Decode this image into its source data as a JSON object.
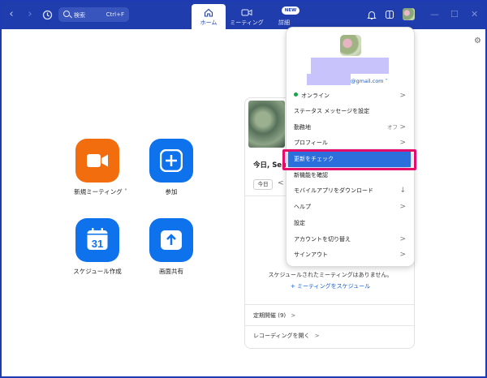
{
  "titlebar": {
    "search_label": "検索",
    "search_shortcut": "Ctrl+F",
    "tabs": [
      {
        "label": "ホーム"
      },
      {
        "label": "ミーティング"
      },
      {
        "label": "詳細"
      }
    ],
    "new_badge": "NEW",
    "icons": [
      "back-arrow",
      "forward-arrow",
      "history",
      "search",
      "home",
      "video",
      "bell",
      "whiteboard",
      "minimize",
      "maximize",
      "close"
    ]
  },
  "tiles": {
    "new_meeting": "新規ミーティング",
    "join": "参加",
    "schedule": "スケジュール作成",
    "share_screen": "画面共有",
    "calendar_day": "31"
  },
  "card": {
    "title": "今日, Sep",
    "today_button": "今日",
    "arrow": "<",
    "empty_text": "スケジュールされたミーティングはありません。",
    "schedule_link": "+ ミーティングをスケジュール",
    "recurring": "定期開催 (9)",
    "recurring_chevron": ">",
    "open_recordings": "レコーディングを開く",
    "open_recordings_chevron": ">"
  },
  "menu": {
    "email_suffix": "@gmail.com",
    "email_chevron": "˅",
    "items": [
      {
        "label": "オンライン",
        "chevron": ">"
      },
      {
        "label": "ステータス メッセージを設定"
      },
      {
        "label": "勤務地",
        "value": "オフ",
        "chevron": ">"
      },
      {
        "label": "プロフィール",
        "chevron": ">"
      },
      {
        "label": "更新をチェック"
      },
      {
        "label": "新機能を確認"
      },
      {
        "label": "モバイルアプリをダウンロード",
        "chevron": "↓"
      },
      {
        "label": "ヘルプ",
        "chevron": ">"
      },
      {
        "label": "設定"
      },
      {
        "label": "アカウントを切り替え",
        "chevron": ">"
      },
      {
        "label": "サインアウト",
        "chevron": ">"
      }
    ]
  },
  "colors": {
    "titlebar": "#1f3dac",
    "accent_blue": "#0e72ed",
    "accent_orange": "#f26d0e",
    "highlight_border": "#e60c6a",
    "online": "#1aa34a"
  }
}
